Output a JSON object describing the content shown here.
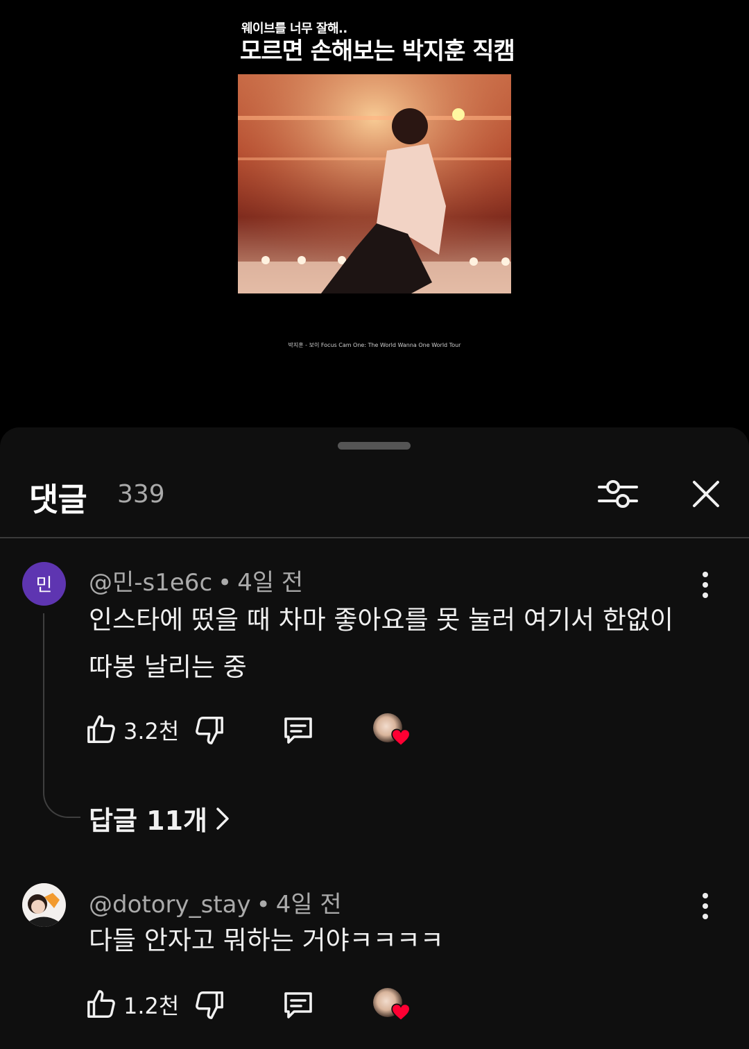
{
  "video": {
    "subtitle": "웨이브를 너무 잘해..",
    "title": "모르면 손해보는 박지훈 직캠",
    "caption": "박지훈 - 보이 Focus Cam One: The World Wanna One World Tour"
  },
  "comments_panel": {
    "title": "댓글",
    "count": "339",
    "filter_icon": "sliders-icon",
    "close_icon": "close-icon",
    "comments": [
      {
        "avatar_letter": "민",
        "avatar_color": "#5e35b1",
        "author": "@민-s1e6c",
        "time": "4일 전",
        "text_line1": "인스타에 떴을 때 차마 좋아요를 못 눌러 여기서 한없이",
        "text_line2": "따봉 날리는 중",
        "likes": "3.2천",
        "replies_label": "답글 11개"
      },
      {
        "author": "@dotory_stay",
        "time": "4일 전",
        "text_line1": "다들 안자고 뭐하는 거야ㅋㅋㅋㅋ",
        "likes": "1.2천"
      }
    ]
  },
  "colors": {
    "sheet_bg": "#0f0f0f",
    "heart": "#ff0033"
  }
}
